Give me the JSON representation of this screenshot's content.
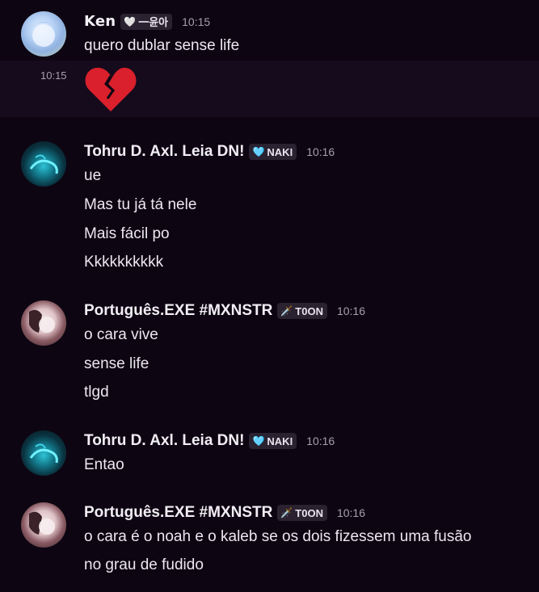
{
  "messages": [
    {
      "user": "Ken",
      "tag": {
        "icon": "🤍",
        "label": "一윤아"
      },
      "time": "10:15",
      "lines": [
        "quero dublar sense life"
      ],
      "avatar": "avatar-ken"
    },
    {
      "continuation": true,
      "time": "10:15",
      "emoji": "broken-heart-icon"
    },
    {
      "user": "Tohru D. Axl. Leia DN!",
      "tag": {
        "icon": "🩵",
        "label": "NAKI"
      },
      "time": "10:16",
      "lines": [
        "ue",
        "Mas tu já tá nele",
        "Mais fácil po",
        "Kkkkkkkkkk"
      ],
      "avatar": "avatar-tohru"
    },
    {
      "user": "Português.EXE #MXNSTR",
      "tag": {
        "icon": "🗡️",
        "label": "T0ON"
      },
      "time": "10:16",
      "lines": [
        "o cara vive",
        "sense life",
        "tlgd"
      ],
      "avatar": "avatar-portugues"
    },
    {
      "user": "Tohru D. Axl. Leia DN!",
      "tag": {
        "icon": "🩵",
        "label": "NAKI"
      },
      "time": "10:16",
      "lines": [
        "Entao"
      ],
      "avatar": "avatar-tohru"
    },
    {
      "user": "Português.EXE #MXNSTR",
      "tag": {
        "icon": "🗡️",
        "label": "T0ON"
      },
      "time": "10:16",
      "lines": [
        "o cara é o noah e o kaleb se os dois fizessem uma fusão",
        "no grau de fudido"
      ],
      "avatar": "avatar-portugues"
    }
  ],
  "colors": {
    "background": "#0d0612",
    "tag_bg": "#2a2230",
    "timestamp": "#a69fae",
    "heart": "#d9202c"
  }
}
